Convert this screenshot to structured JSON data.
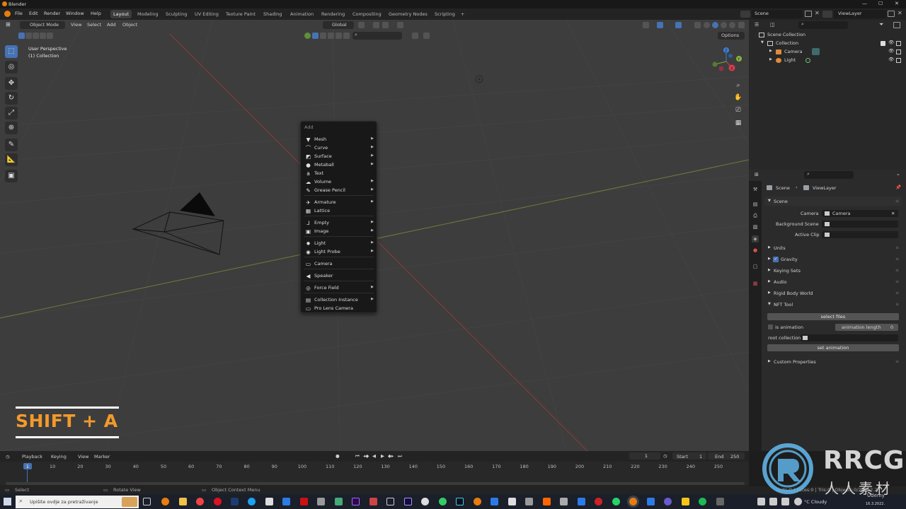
{
  "window": {
    "title": "Blender",
    "controls": [
      "—",
      "☐",
      "✕"
    ]
  },
  "topbar": {
    "menus": [
      "File",
      "Edit",
      "Render",
      "Window",
      "Help"
    ],
    "workspaces": [
      "Layout",
      "Modeling",
      "Sculpting",
      "UV Editing",
      "Texture Paint",
      "Shading",
      "Animation",
      "Rendering",
      "Compositing",
      "Geometry Nodes",
      "Scripting"
    ],
    "active_workspace": "Layout",
    "add_tab": "+",
    "scene": "Scene",
    "view_layer": "ViewLayer"
  },
  "viewport_header": {
    "mode": "Object Mode",
    "menus": [
      "View",
      "Select",
      "Add",
      "Object"
    ],
    "orientation": "Global",
    "options": "Options"
  },
  "viewport_overlay": {
    "perspective": "User Perspective",
    "collection": "(1) Collection"
  },
  "gizmo": {
    "x": "X",
    "y": "Y",
    "z": "Z"
  },
  "add_menu": {
    "title": "Add",
    "items": [
      {
        "label": "Mesh",
        "icon": "mesh-icon",
        "submenu": true
      },
      {
        "label": "Curve",
        "icon": "curve-icon",
        "submenu": true
      },
      {
        "label": "Surface",
        "icon": "surface-icon",
        "submenu": true
      },
      {
        "label": "Metaball",
        "icon": "metaball-icon",
        "submenu": true
      },
      {
        "label": "Text",
        "icon": "text-icon",
        "submenu": false
      },
      {
        "label": "Volume",
        "icon": "volume-icon",
        "submenu": true
      },
      {
        "label": "Grease Pencil",
        "icon": "grease-pencil-icon",
        "submenu": true
      },
      {
        "label": "Armature",
        "icon": "armature-icon",
        "submenu": true
      },
      {
        "label": "Lattice",
        "icon": "lattice-icon",
        "submenu": false
      },
      {
        "label": "Empty",
        "icon": "empty-icon",
        "submenu": true
      },
      {
        "label": "Image",
        "icon": "image-icon",
        "submenu": true
      },
      {
        "label": "Light",
        "icon": "light-icon",
        "submenu": true
      },
      {
        "label": "Light Probe",
        "icon": "light-probe-icon",
        "submenu": true
      },
      {
        "label": "Camera",
        "icon": "camera-icon",
        "submenu": false
      },
      {
        "label": "Speaker",
        "icon": "speaker-icon",
        "submenu": false
      },
      {
        "label": "Force Field",
        "icon": "force-field-icon",
        "submenu": true
      },
      {
        "label": "Collection Instance",
        "icon": "collection-instance-icon",
        "submenu": true
      },
      {
        "label": "Pro Lens Camera",
        "icon": "pro-lens-camera-icon",
        "submenu": false
      }
    ]
  },
  "outliner": {
    "root": "Scene Collection",
    "collection": "Collection",
    "objects": [
      "Camera",
      "Light"
    ]
  },
  "properties": {
    "breadcrumb": [
      "Scene",
      "ViewLayer"
    ],
    "scene_panel": "Scene",
    "fields": [
      {
        "label": "Camera",
        "value": "Camera"
      },
      {
        "label": "Background Scene",
        "value": ""
      },
      {
        "label": "Active Clip",
        "value": ""
      }
    ],
    "panels": [
      "Units",
      "Gravity",
      "Keying Sets",
      "Audio",
      "Rigid Body World",
      "NFT Tool"
    ],
    "gravity_checked": true,
    "nft": {
      "select_files": "select files",
      "is_animation": "is animation",
      "animation_length_label": "animation length",
      "animation_length_value": "0",
      "root_collection": "root collection:",
      "set_animation": "set animation"
    },
    "custom_properties": "Custom Properties"
  },
  "timeline": {
    "menus": [
      "Playback",
      "Keying",
      "View",
      "Marker"
    ],
    "current_frame": "1",
    "start_label": "Start",
    "start": "1",
    "end_label": "End",
    "end": "250",
    "ticks": [
      "1",
      "10",
      "20",
      "30",
      "40",
      "50",
      "60",
      "70",
      "80",
      "90",
      "100",
      "110",
      "120",
      "130",
      "140",
      "150",
      "160",
      "170",
      "180",
      "190",
      "200",
      "210",
      "220",
      "230",
      "240",
      "250"
    ]
  },
  "statusbar": {
    "select": "Select",
    "rotate": "Rotate View",
    "context": "Object Context Menu",
    "stats": "Verts:0 | Faces:0 | Tris:0 | Objects:0/2 | 3.2.2"
  },
  "taskbar": {
    "search_placeholder": "Upišite ovdje za pretraživanje",
    "weather": "°C Cloudy",
    "date": "16.3.2022."
  },
  "overlay_caption": "SHIFT + A",
  "watermark": {
    "logo_text": "RRCG",
    "sub_text": "人人素材",
    "udemy": "Udemy"
  }
}
